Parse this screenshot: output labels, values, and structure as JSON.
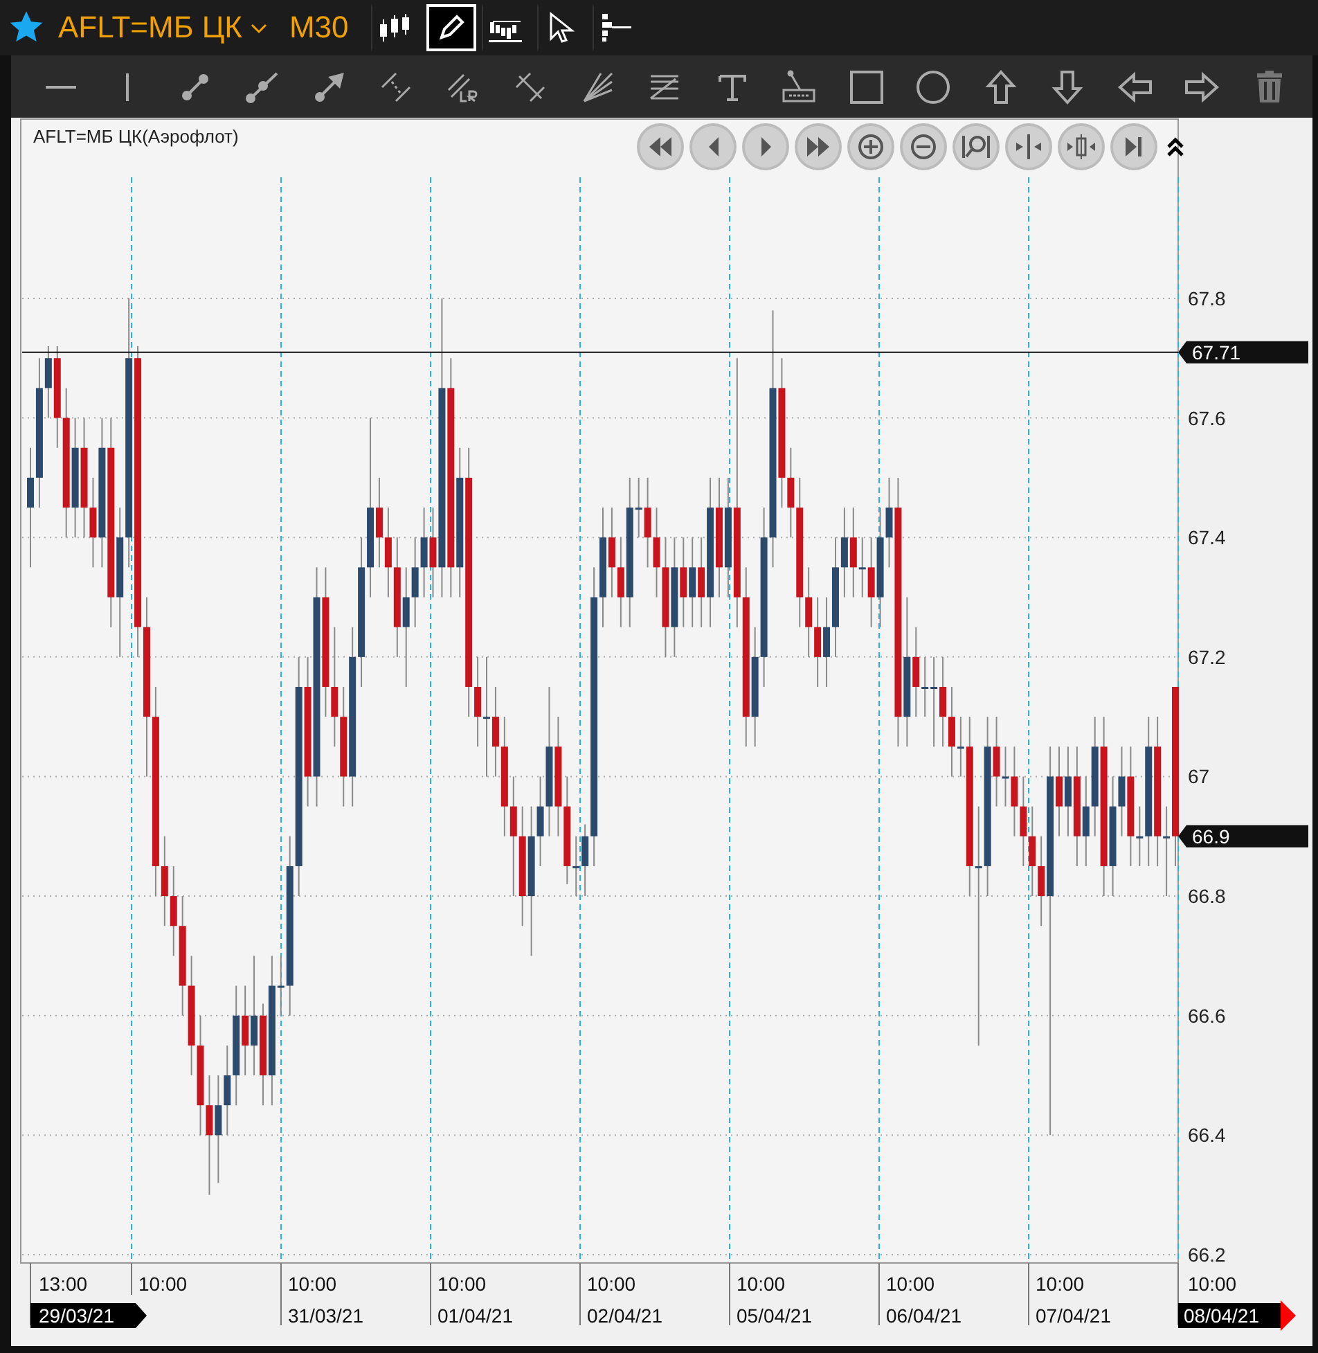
{
  "header": {
    "symbol": "AFLT=МБ ЦК",
    "timeframe": "M30",
    "favorite": true,
    "view_tools": [
      {
        "kind": "candles",
        "selected": false
      },
      {
        "kind": "draw",
        "selected": true
      },
      {
        "kind": "volume",
        "selected": false
      },
      {
        "kind": "cursor",
        "selected": false
      },
      {
        "kind": "depth",
        "selected": false
      }
    ]
  },
  "drawing_tools": [
    {
      "kind": "hline"
    },
    {
      "kind": "vline"
    },
    {
      "kind": "segment"
    },
    {
      "kind": "ray"
    },
    {
      "kind": "arrow"
    },
    {
      "kind": "channel"
    },
    {
      "kind": "regression"
    },
    {
      "kind": "pitchfork"
    },
    {
      "kind": "fan"
    },
    {
      "kind": "fibo"
    },
    {
      "kind": "text"
    },
    {
      "kind": "label"
    },
    {
      "kind": "rect"
    },
    {
      "kind": "circle"
    },
    {
      "kind": "up"
    },
    {
      "kind": "down"
    },
    {
      "kind": "left"
    },
    {
      "kind": "right"
    },
    {
      "kind": "trash"
    }
  ],
  "chart": {
    "title": "AFLT=МБ ЦК(Аэрофлот)",
    "nav_buttons": [
      {
        "kind": "fast-back"
      },
      {
        "kind": "back"
      },
      {
        "kind": "forward"
      },
      {
        "kind": "fast-forward"
      },
      {
        "kind": "zoom-in"
      },
      {
        "kind": "zoom-out"
      },
      {
        "kind": "zoom-fit"
      },
      {
        "kind": "shrink"
      },
      {
        "kind": "expand"
      },
      {
        "kind": "end"
      }
    ],
    "y_ticks": [
      "67.8",
      "67.6",
      "67.4",
      "67.2",
      "67",
      "66.8",
      "66.6",
      "66.4",
      "66.2"
    ],
    "price_labels": [
      {
        "text": "66.9",
        "kind": "last"
      }
    ],
    "x_axis": [
      {
        "time": "13:00",
        "date": "29/03/21",
        "kind": "start"
      },
      {
        "time": "10:00"
      },
      {
        "time": "10:00",
        "date": "31/03/21"
      },
      {
        "time": "10:00",
        "date": "01/04/21"
      },
      {
        "time": "10:00",
        "date": "02/04/21"
      },
      {
        "time": "10:00",
        "date": "05/04/21"
      },
      {
        "time": "10:00",
        "date": "06/04/21"
      },
      {
        "time": "10:00",
        "date": "07/04/21"
      },
      {
        "time": "10:00",
        "date": "08/04/21",
        "kind": "end"
      }
    ],
    "chart_data": {
      "type": "candlestick",
      "ylim": [
        66.2,
        68.1
      ],
      "yticks": [
        66.2,
        66.4,
        66.6,
        66.8,
        67,
        67.2,
        67.4,
        67.6,
        67.8
      ],
      "grid": true,
      "ref_lines": [
        {
          "axis": "y",
          "value": 67.71,
          "label": "67.71"
        }
      ],
      "ohlc": [
        [
          67.45,
          67.55,
          67.35,
          67.5
        ],
        [
          67.5,
          67.7,
          67.45,
          67.65
        ],
        [
          67.65,
          67.72,
          67.6,
          67.7
        ],
        [
          67.7,
          67.72,
          67.55,
          67.6
        ],
        [
          67.6,
          67.65,
          67.4,
          67.45
        ],
        [
          67.45,
          67.6,
          67.4,
          67.55
        ],
        [
          67.55,
          67.6,
          67.4,
          67.45
        ],
        [
          67.45,
          67.5,
          67.35,
          67.4
        ],
        [
          67.4,
          67.6,
          67.35,
          67.55
        ],
        [
          67.55,
          67.6,
          67.25,
          67.3
        ],
        [
          67.3,
          67.45,
          67.2,
          67.4
        ],
        [
          67.4,
          67.8,
          67.35,
          67.7
        ],
        [
          67.7,
          67.72,
          67.2,
          67.25
        ],
        [
          67.25,
          67.3,
          67.0,
          67.1
        ],
        [
          67.1,
          67.15,
          66.8,
          66.85
        ],
        [
          66.85,
          66.9,
          66.75,
          66.8
        ],
        [
          66.8,
          66.85,
          66.7,
          66.75
        ],
        [
          66.75,
          66.8,
          66.6,
          66.65
        ],
        [
          66.65,
          66.7,
          66.5,
          66.55
        ],
        [
          66.55,
          66.6,
          66.4,
          66.45
        ],
        [
          66.45,
          66.5,
          66.3,
          66.4
        ],
        [
          66.4,
          66.5,
          66.32,
          66.45
        ],
        [
          66.45,
          66.55,
          66.4,
          66.5
        ],
        [
          66.5,
          66.65,
          66.45,
          66.6
        ],
        [
          66.6,
          66.65,
          66.5,
          66.55
        ],
        [
          66.55,
          66.7,
          66.5,
          66.6
        ],
        [
          66.6,
          66.62,
          66.45,
          66.5
        ],
        [
          66.5,
          66.7,
          66.45,
          66.65
        ],
        [
          66.65,
          66.7,
          66.6,
          66.65
        ],
        [
          66.65,
          66.9,
          66.6,
          66.85
        ],
        [
          66.85,
          67.2,
          66.8,
          67.15
        ],
        [
          67.15,
          67.2,
          66.95,
          67.0
        ],
        [
          67.0,
          67.35,
          66.95,
          67.3
        ],
        [
          67.3,
          67.35,
          67.1,
          67.15
        ],
        [
          67.15,
          67.25,
          67.05,
          67.1
        ],
        [
          67.1,
          67.15,
          66.95,
          67.0
        ],
        [
          67.0,
          67.25,
          66.95,
          67.2
        ],
        [
          67.2,
          67.4,
          67.15,
          67.35
        ],
        [
          67.35,
          67.6,
          67.3,
          67.45
        ],
        [
          67.45,
          67.5,
          67.35,
          67.4
        ],
        [
          67.4,
          67.45,
          67.3,
          67.35
        ],
        [
          67.35,
          67.4,
          67.2,
          67.25
        ],
        [
          67.25,
          67.35,
          67.15,
          67.3
        ],
        [
          67.3,
          67.4,
          67.25,
          67.35
        ],
        [
          67.35,
          67.45,
          67.3,
          67.4
        ],
        [
          67.4,
          67.45,
          67.3,
          67.35
        ],
        [
          67.35,
          67.8,
          67.3,
          67.65
        ],
        [
          67.65,
          67.7,
          67.3,
          67.35
        ],
        [
          67.35,
          67.55,
          67.3,
          67.5
        ],
        [
          67.5,
          67.55,
          67.1,
          67.15
        ],
        [
          67.15,
          67.2,
          67.05,
          67.1
        ],
        [
          67.1,
          67.2,
          67.0,
          67.1
        ],
        [
          67.1,
          67.15,
          67.0,
          67.05
        ],
        [
          67.05,
          67.1,
          66.9,
          66.95
        ],
        [
          66.95,
          67.0,
          66.8,
          66.9
        ],
        [
          66.9,
          66.95,
          66.75,
          66.8
        ],
        [
          66.8,
          66.95,
          66.7,
          66.9
        ],
        [
          66.9,
          67.0,
          66.85,
          66.95
        ],
        [
          66.95,
          67.15,
          66.9,
          67.05
        ],
        [
          67.05,
          67.1,
          66.9,
          66.95
        ],
        [
          66.95,
          67.0,
          66.82,
          66.85
        ],
        [
          66.85,
          66.9,
          66.8,
          66.85
        ],
        [
          66.85,
          66.92,
          66.8,
          66.9
        ],
        [
          66.9,
          67.35,
          66.85,
          67.3
        ],
        [
          67.3,
          67.45,
          67.25,
          67.4
        ],
        [
          67.4,
          67.45,
          67.3,
          67.35
        ],
        [
          67.35,
          67.4,
          67.25,
          67.3
        ],
        [
          67.3,
          67.5,
          67.25,
          67.45
        ],
        [
          67.45,
          67.5,
          67.4,
          67.45
        ],
        [
          67.45,
          67.5,
          67.35,
          67.4
        ],
        [
          67.4,
          67.45,
          67.3,
          67.35
        ],
        [
          67.35,
          67.4,
          67.2,
          67.25
        ],
        [
          67.25,
          67.4,
          67.2,
          67.35
        ],
        [
          67.35,
          67.4,
          67.25,
          67.3
        ],
        [
          67.3,
          67.4,
          67.25,
          67.35
        ],
        [
          67.35,
          67.4,
          67.25,
          67.3
        ],
        [
          67.3,
          67.5,
          67.25,
          67.45
        ],
        [
          67.45,
          67.5,
          67.3,
          67.35
        ],
        [
          67.35,
          67.5,
          67.3,
          67.45
        ],
        [
          67.45,
          67.7,
          67.25,
          67.3
        ],
        [
          67.3,
          67.35,
          67.05,
          67.1
        ],
        [
          67.1,
          67.25,
          67.05,
          67.2
        ],
        [
          67.2,
          67.45,
          67.15,
          67.4
        ],
        [
          67.4,
          67.78,
          67.35,
          67.65
        ],
        [
          67.65,
          67.7,
          67.45,
          67.5
        ],
        [
          67.5,
          67.55,
          67.4,
          67.45
        ],
        [
          67.45,
          67.5,
          67.25,
          67.3
        ],
        [
          67.3,
          67.35,
          67.2,
          67.25
        ],
        [
          67.25,
          67.3,
          67.15,
          67.2
        ],
        [
          67.2,
          67.3,
          67.15,
          67.25
        ],
        [
          67.25,
          67.4,
          67.2,
          67.35
        ],
        [
          67.35,
          67.45,
          67.3,
          67.4
        ],
        [
          67.4,
          67.45,
          67.3,
          67.35
        ],
        [
          67.35,
          67.4,
          67.3,
          67.35
        ],
        [
          67.35,
          67.4,
          67.25,
          67.3
        ],
        [
          67.3,
          67.45,
          67.25,
          67.4
        ],
        [
          67.4,
          67.5,
          67.35,
          67.45
        ],
        [
          67.45,
          67.5,
          67.05,
          67.1
        ],
        [
          67.1,
          67.3,
          67.05,
          67.2
        ],
        [
          67.2,
          67.25,
          67.1,
          67.15
        ],
        [
          67.15,
          67.2,
          67.1,
          67.15
        ],
        [
          67.15,
          67.2,
          67.05,
          67.15
        ],
        [
          67.15,
          67.2,
          67.05,
          67.1
        ],
        [
          67.1,
          67.15,
          67.0,
          67.05
        ],
        [
          67.05,
          67.1,
          67.0,
          67.05
        ],
        [
          67.05,
          67.1,
          66.8,
          66.85
        ],
        [
          66.85,
          66.95,
          66.55,
          66.85
        ],
        [
          66.85,
          67.1,
          66.8,
          67.05
        ],
        [
          67.05,
          67.1,
          66.95,
          67.0
        ],
        [
          67.0,
          67.05,
          66.95,
          67.0
        ],
        [
          67.0,
          67.05,
          66.9,
          66.95
        ],
        [
          66.95,
          67.0,
          66.85,
          66.9
        ],
        [
          66.9,
          66.95,
          66.8,
          66.85
        ],
        [
          66.85,
          66.9,
          66.75,
          66.8
        ],
        [
          66.8,
          67.05,
          66.4,
          67.0
        ],
        [
          67.0,
          67.05,
          66.9,
          66.95
        ],
        [
          66.95,
          67.05,
          66.9,
          67.0
        ],
        [
          67.0,
          67.05,
          66.85,
          66.9
        ],
        [
          66.9,
          67.0,
          66.85,
          66.95
        ],
        [
          66.95,
          67.1,
          66.9,
          67.05
        ],
        [
          67.05,
          67.1,
          66.8,
          66.85
        ],
        [
          66.85,
          67.0,
          66.8,
          66.95
        ],
        [
          66.95,
          67.05,
          66.9,
          67.0
        ],
        [
          67.0,
          67.05,
          66.85,
          66.9
        ],
        [
          66.9,
          66.95,
          66.85,
          66.9
        ],
        [
          66.9,
          67.1,
          66.85,
          67.05
        ],
        [
          67.05,
          67.1,
          66.85,
          66.9
        ],
        [
          66.9,
          66.95,
          66.8,
          66.9
        ],
        [
          67.15,
          67.15,
          66.85,
          66.9
        ]
      ]
    }
  }
}
